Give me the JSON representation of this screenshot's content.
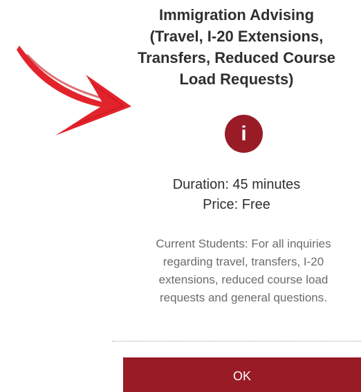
{
  "modal": {
    "title": "Immigration Advising\n(Travel, I-20 Extensions,\nTransfers, Reduced Course\nLoad Requests)",
    "info_icon": "info-icon",
    "duration": "Duration: 45 minutes",
    "price": "Price: Free",
    "description": "Current Students: For all inquiries\nregarding travel, transfers, I-20\nextensions, reduced course load\nrequests and general questions.",
    "ok_label": "OK"
  },
  "annotation": {
    "arrow_icon": "red-arrow-icon"
  },
  "colors": {
    "accent": "#981b26",
    "arrow": "#e3232b",
    "title_text": "#2f2f2f",
    "description_text": "#6b6b6b"
  }
}
